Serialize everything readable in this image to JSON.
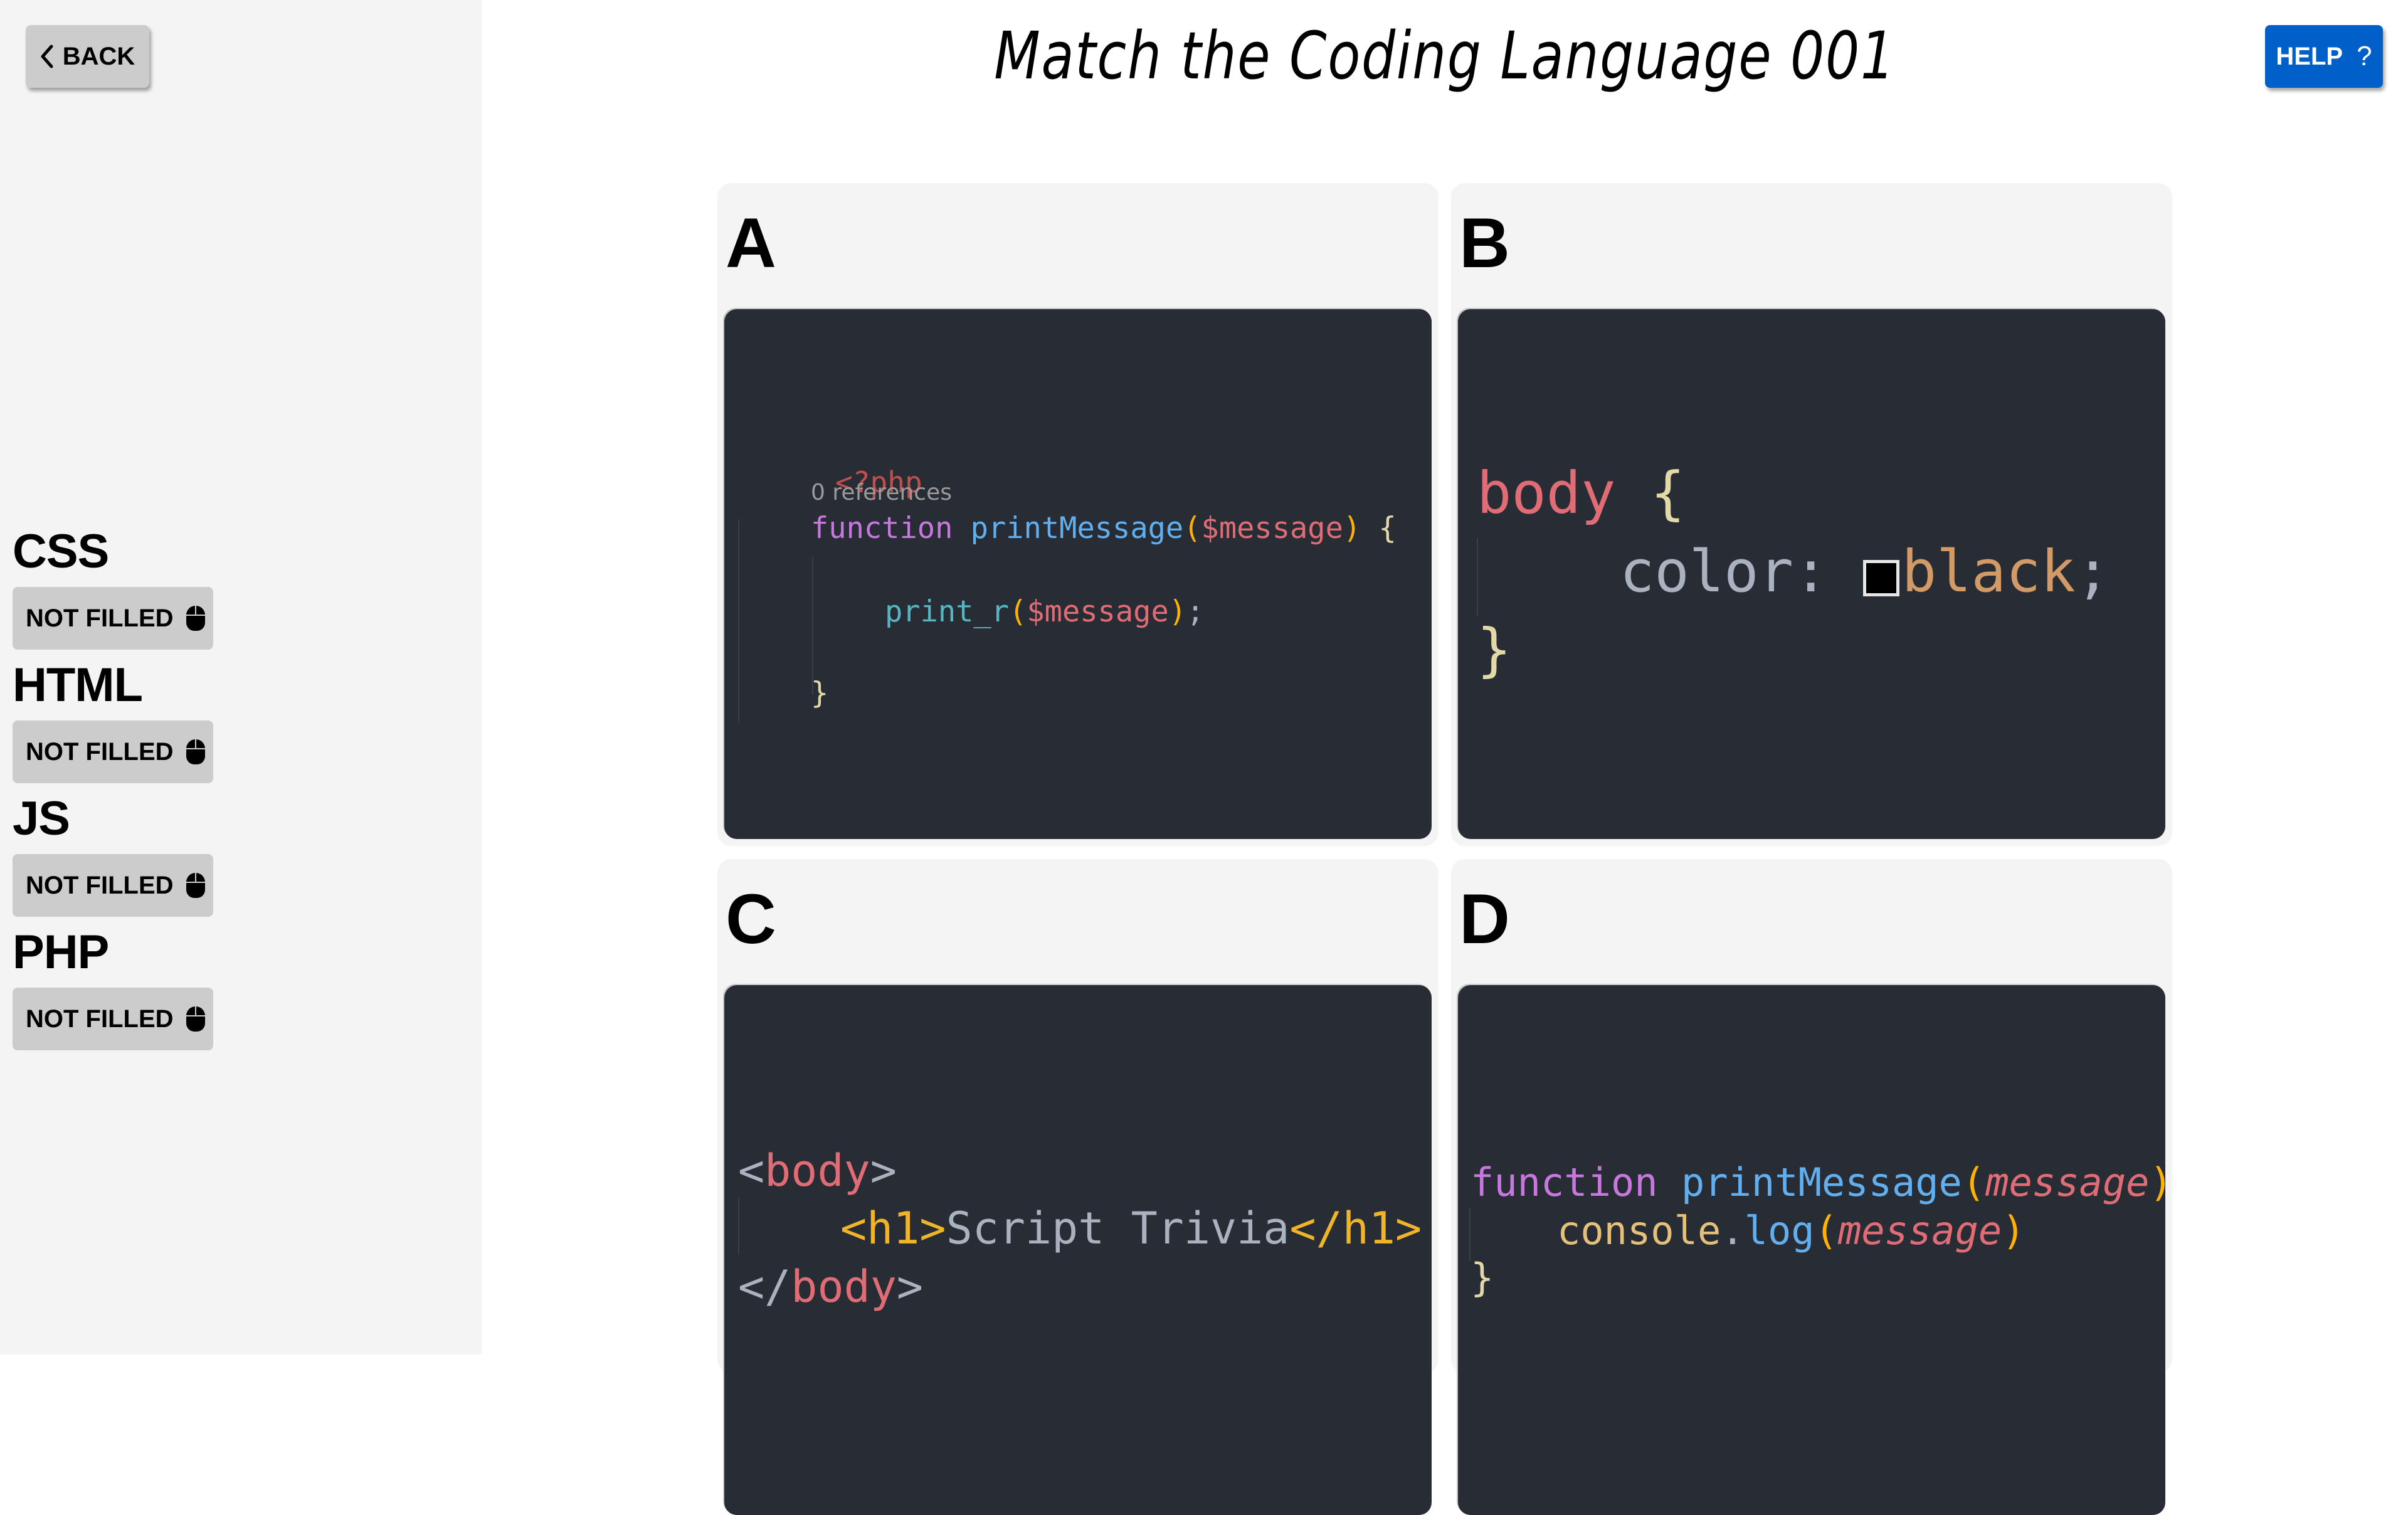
{
  "header": {
    "back_label": "BACK",
    "help_label": "HELP",
    "help_icon": "?",
    "title": "Match the Coding Language 001"
  },
  "sidebar": {
    "languages": [
      {
        "label": "CSS",
        "status": "NOT FILLED"
      },
      {
        "label": "HTML",
        "status": "NOT FILLED"
      },
      {
        "label": "JS",
        "status": "NOT FILLED"
      },
      {
        "label": "PHP",
        "status": "NOT FILLED"
      }
    ],
    "status_icon": "mouse-icon"
  },
  "cards": [
    {
      "letter": "A",
      "code": {
        "open_tag": "<?php",
        "codelens": "0 references",
        "kw_function": "function",
        "fn_name": "printMessage",
        "paren_open": "(",
        "param": "$message",
        "paren_close": ")",
        "brace_open": "{",
        "call": "print_r",
        "call_arg": "$message",
        "call_semicolon": ";",
        "brace_close": "}"
      }
    },
    {
      "letter": "B",
      "code": {
        "selector": "body",
        "brace_open": "{",
        "property": "color:",
        "value": "black",
        "semicolon": ";",
        "brace_close": "}",
        "swatch_color": "#000000"
      }
    },
    {
      "letter": "C",
      "code": {
        "lt1": "<",
        "body_open": "body",
        "gt1": ">",
        "h1_open": "<h1>",
        "text": "Script Trivia",
        "h1_close": "</h1>",
        "close_lt": "</",
        "body_close": "body",
        "gt2": ">"
      }
    },
    {
      "letter": "D",
      "code": {
        "kw_function": "function",
        "fn_name": "printMessage",
        "paren_open": "(",
        "param": "message",
        "paren_close": ")",
        "brace_open": "{",
        "obj": "console",
        "dot": ".",
        "method": "log",
        "arg_open": "(",
        "arg": "message",
        "arg_close": ")",
        "brace_close": "}"
      }
    }
  ],
  "colors": {
    "sidebar_bg": "#f4f4f4",
    "button_bg": "#cccccc",
    "help_bg": "#005fc8",
    "code_bg": "#282c35",
    "card_bg": "#f4f4f4"
  }
}
